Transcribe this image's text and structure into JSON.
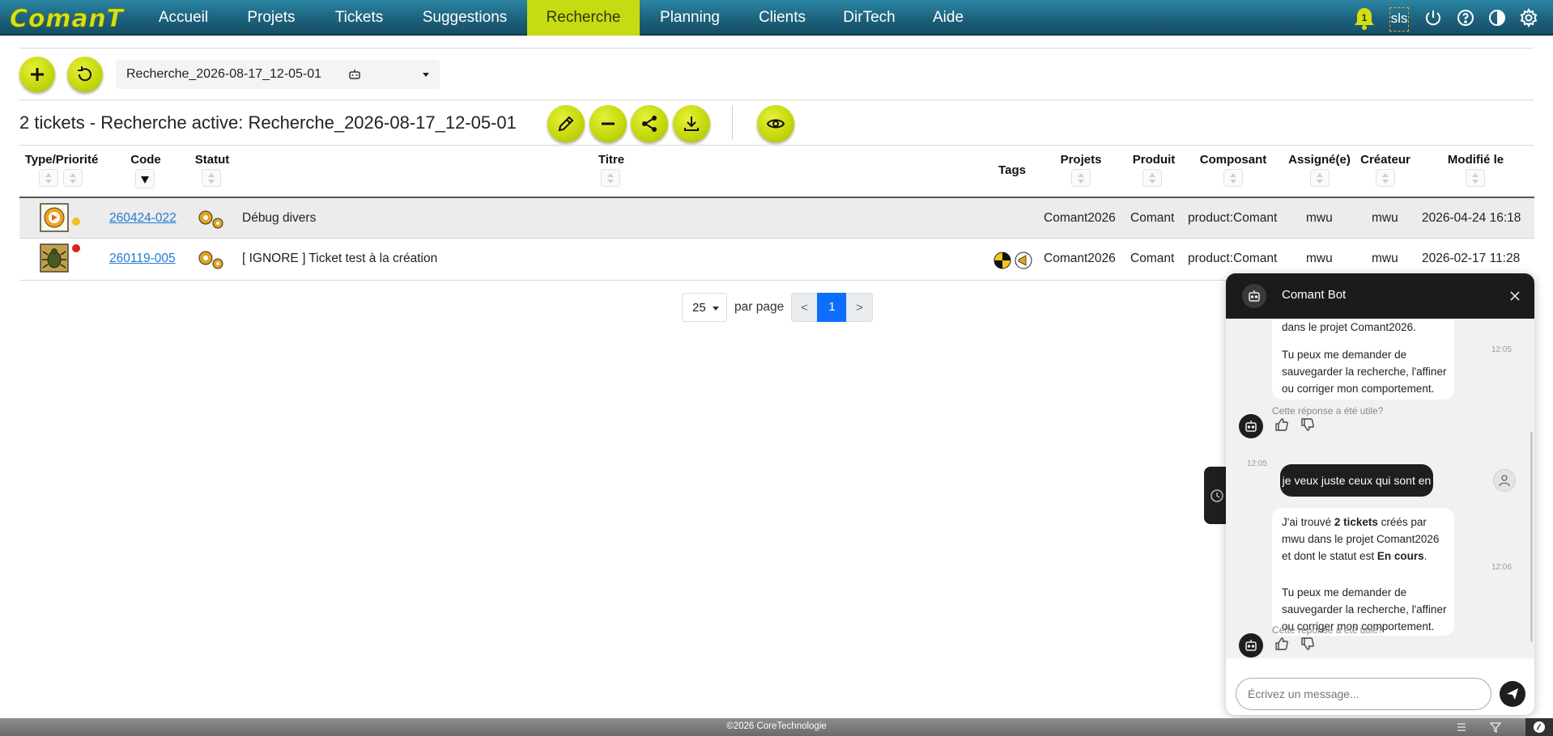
{
  "nav": {
    "logo_text": "ComanT",
    "items": [
      "Accueil",
      "Projets",
      "Tickets",
      "Suggestions",
      "Recherche",
      "Planning",
      "Clients",
      "DirTech",
      "Aide"
    ],
    "active": "Recherche",
    "notification_count": "1",
    "user_initials": "sls",
    "accent_color": "#c6dc12"
  },
  "toolbar": {
    "search_name": "Recherche_2026-08-17_12-05-01"
  },
  "results": {
    "title": "2 tickets - Recherche active: Recherche_2026-08-17_12-05-01"
  },
  "table": {
    "headers": {
      "type": "Type/Priorité",
      "code": "Code",
      "statut": "Statut",
      "titre": "Titre",
      "tags": "Tags",
      "projets": "Projets",
      "produit": "Produit",
      "composant": "Composant",
      "assigne": "Assigné(e)",
      "createur": "Créateur",
      "modifie": "Modifié le"
    },
    "rows": [
      {
        "type_icon": "gear-play-icon",
        "priority_color": "#f2c01c",
        "code": "260424-022",
        "status_icon": "gears-icon",
        "titre": "Débug divers",
        "tags": [],
        "projet": "Comant2026",
        "produit": "Comant",
        "composant": "product:Comant",
        "assigne": "mwu",
        "createur": "mwu",
        "modifie": "2026-04-24 16:18"
      },
      {
        "type_icon": "bug-icon",
        "priority_color": "#e02020",
        "code": "260119-005",
        "status_icon": "gears-icon",
        "titre": "[ IGNORE ] Ticket test à la création",
        "tags": [
          "crash-test-icon",
          "megaphone-icon"
        ],
        "projet": "Comant2026",
        "produit": "Comant",
        "composant": "product:Comant",
        "assigne": "mwu",
        "createur": "mwu",
        "modifie": "2026-02-17 11:28"
      }
    ]
  },
  "pagination": {
    "page_size": "25",
    "per_page_label": "par page",
    "prev": "<",
    "current": "1",
    "next": ">"
  },
  "chat": {
    "title": "Comant Bot",
    "msg1": {
      "line_top": "dans le projet Comant2026.",
      "para2": "Tu peux me demander de sauvegarder la recherche, l'affiner ou corriger mon comportement.",
      "time": "12:05"
    },
    "useful_label": "Cette réponse a été utile?",
    "user_msg": "je veux juste ceux qui sont en cours",
    "user_time": "12:05",
    "msg2": {
      "p1_a": "J'ai trouvé ",
      "p1_b": "2 tickets",
      "p1_c": " créés par mwu dans le projet Comant2026 et dont le statut est ",
      "p1_d": "En cours",
      "p1_e": ".",
      "para2": "Tu peux me demander de sauvegarder la recherche, l'affiner ou corriger mon comportement.",
      "time": "12:06"
    },
    "input_placeholder": "Écrivez un message..."
  },
  "footer": {
    "text": "©2026 CoreTechnologie"
  }
}
